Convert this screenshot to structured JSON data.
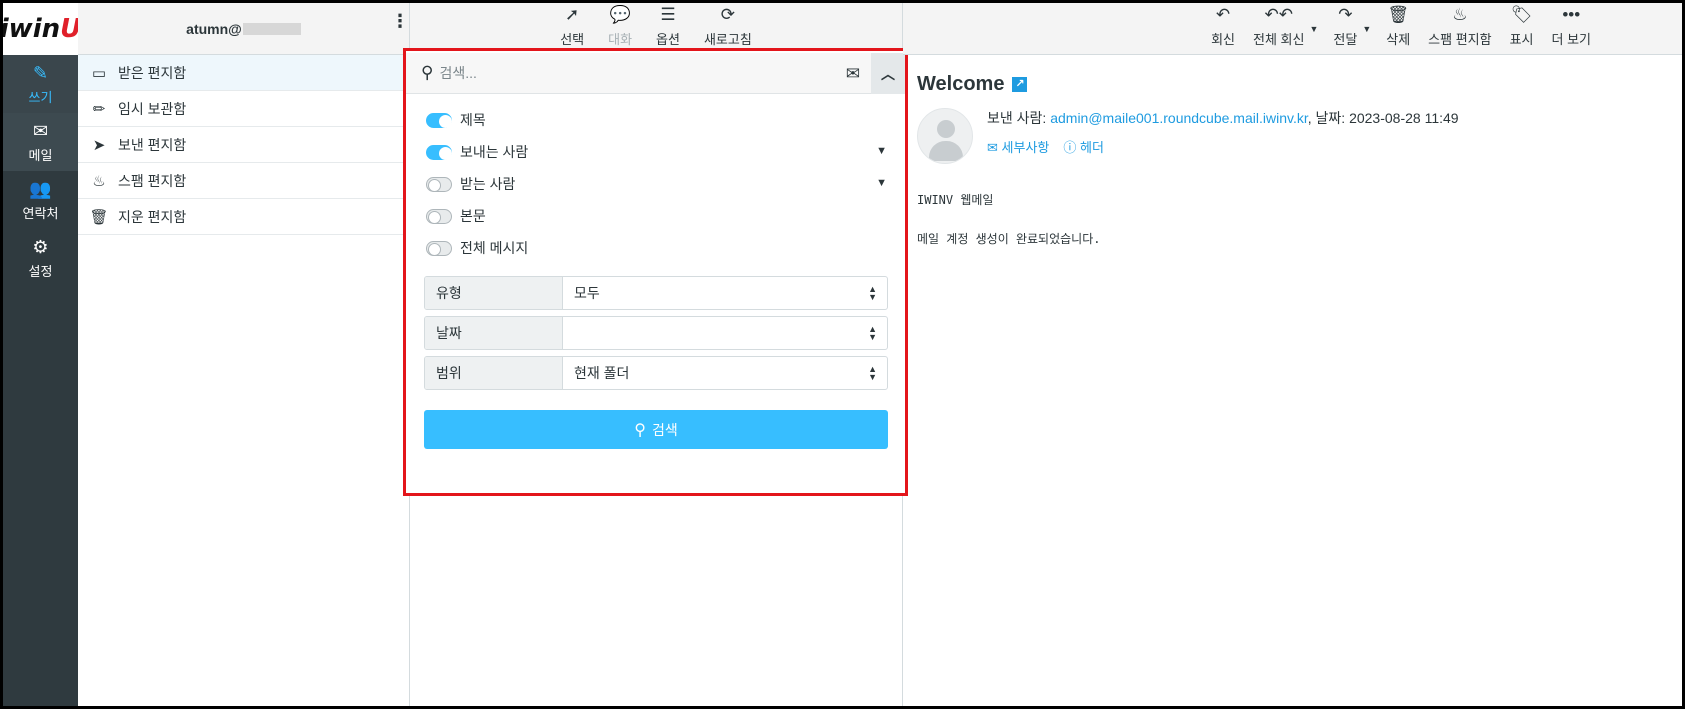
{
  "app": {
    "logo_main": "iwin",
    "logo_accent": "U"
  },
  "nav": [
    {
      "label": "쓰기",
      "icon": "compose-icon"
    },
    {
      "label": "메일",
      "icon": "envelope-icon"
    },
    {
      "label": "연락처",
      "icon": "contacts-icon"
    },
    {
      "label": "설정",
      "icon": "gear-icon"
    }
  ],
  "account": {
    "email_visible": "atumn@"
  },
  "folders": [
    {
      "label": "받은 편지함",
      "icon": "inbox-icon"
    },
    {
      "label": "임시 보관함",
      "icon": "pencil-icon"
    },
    {
      "label": "보낸 편지함",
      "icon": "paper-plane-icon"
    },
    {
      "label": "스팸 편지함",
      "icon": "fire-icon"
    },
    {
      "label": "지운 편지함",
      "icon": "trash-icon"
    }
  ],
  "list_toolbar": {
    "select": "선택",
    "thread": "대화",
    "options": "옵션",
    "refresh": "새로고침"
  },
  "search": {
    "placeholder": "검색...",
    "options": [
      {
        "label": "제목",
        "on": true
      },
      {
        "label": "보내는 사람",
        "on": true
      },
      {
        "label": "받는 사람",
        "on": false
      },
      {
        "label": "본문",
        "on": false
      },
      {
        "label": "전체 메시지",
        "on": false
      }
    ],
    "type_label": "유형",
    "type_value": "모두",
    "date_label": "날짜",
    "date_value": "",
    "scope_label": "범위",
    "scope_value": "현재 폴더",
    "button_label": "검색"
  },
  "message_toolbar": {
    "reply": "회신",
    "reply_all": "전체 회신",
    "forward": "전달",
    "delete": "삭제",
    "spam": "스팸 편지함",
    "mark": "표시",
    "more": "더 보기"
  },
  "message": {
    "subject": "Welcome",
    "from_label": "보낸 사람:",
    "from_address": "admin@maile001.roundcube.mail.iwinv.kr",
    "date_label": ", 날짜:",
    "date_value": "2023-08-28 11:49",
    "details_link": "세부사항",
    "headers_link": "헤더",
    "body_line1": "IWINV 웹메일",
    "body_line2": "메일 계정 생성이 완료되었습니다."
  },
  "colors": {
    "accent": "#37beff",
    "link": "#1e9be0",
    "highlight_border": "#e3151b",
    "nav_bg": "#2f3a3f"
  }
}
